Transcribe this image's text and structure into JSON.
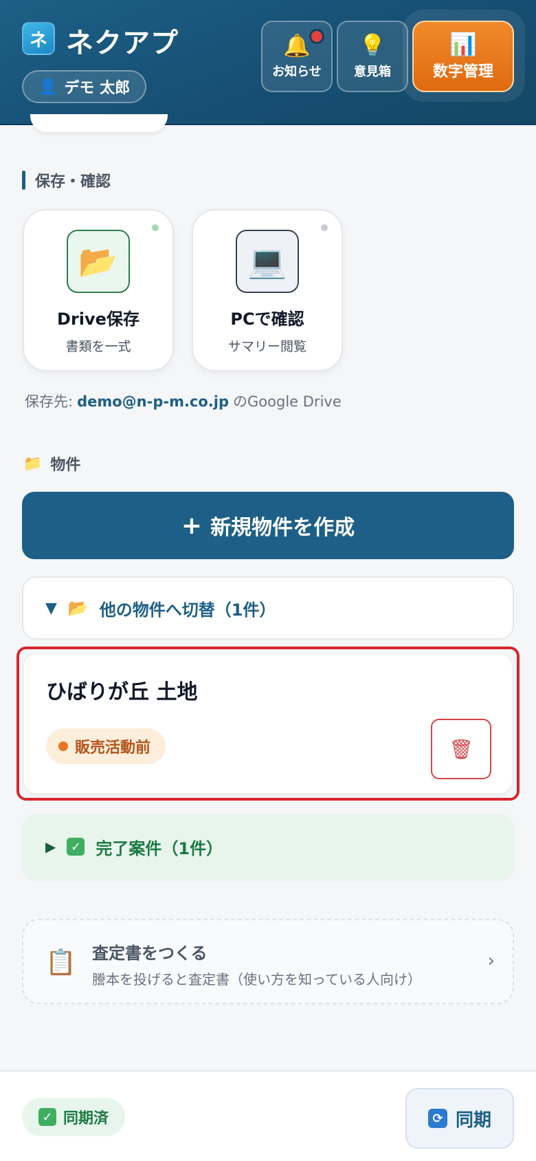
{
  "header": {
    "logo_char": "ネ",
    "app_title": "ネクアプ",
    "user_name": "デモ 太郎",
    "notice_label": "お知らせ",
    "idea_label": "意見箱",
    "numbers_label": "数字管理",
    "has_unread_notice": true
  },
  "save_section": {
    "heading": "保存・確認",
    "drive_card": {
      "title": "Drive保存",
      "subtitle": "書類を一式"
    },
    "pc_card": {
      "title": "PCで確認",
      "subtitle": "サマリー閲覧"
    },
    "dest_prefix": "保存先:",
    "dest_email": "demo@n-p-m.co.jp",
    "dest_suffix": "のGoogle Drive"
  },
  "properties": {
    "heading": "物件",
    "create_label": "新規物件を作成",
    "switch_label": "他の物件へ切替（1件）",
    "current": {
      "name": "ひばりが丘 土地",
      "status": "販売活動前"
    },
    "done_label": "完了案件（1件）"
  },
  "assessment": {
    "title": "査定書をつくる",
    "subtitle": "謄本を投げると査定書（使い方を知っている人向け）"
  },
  "footer": {
    "synced_label": "同期済",
    "sync_label": "同期"
  },
  "colors": {
    "brand": "#1d5f86",
    "accent_orange": "#e06a10",
    "highlight_red": "#d6262c",
    "success_green": "#1e7a44"
  }
}
